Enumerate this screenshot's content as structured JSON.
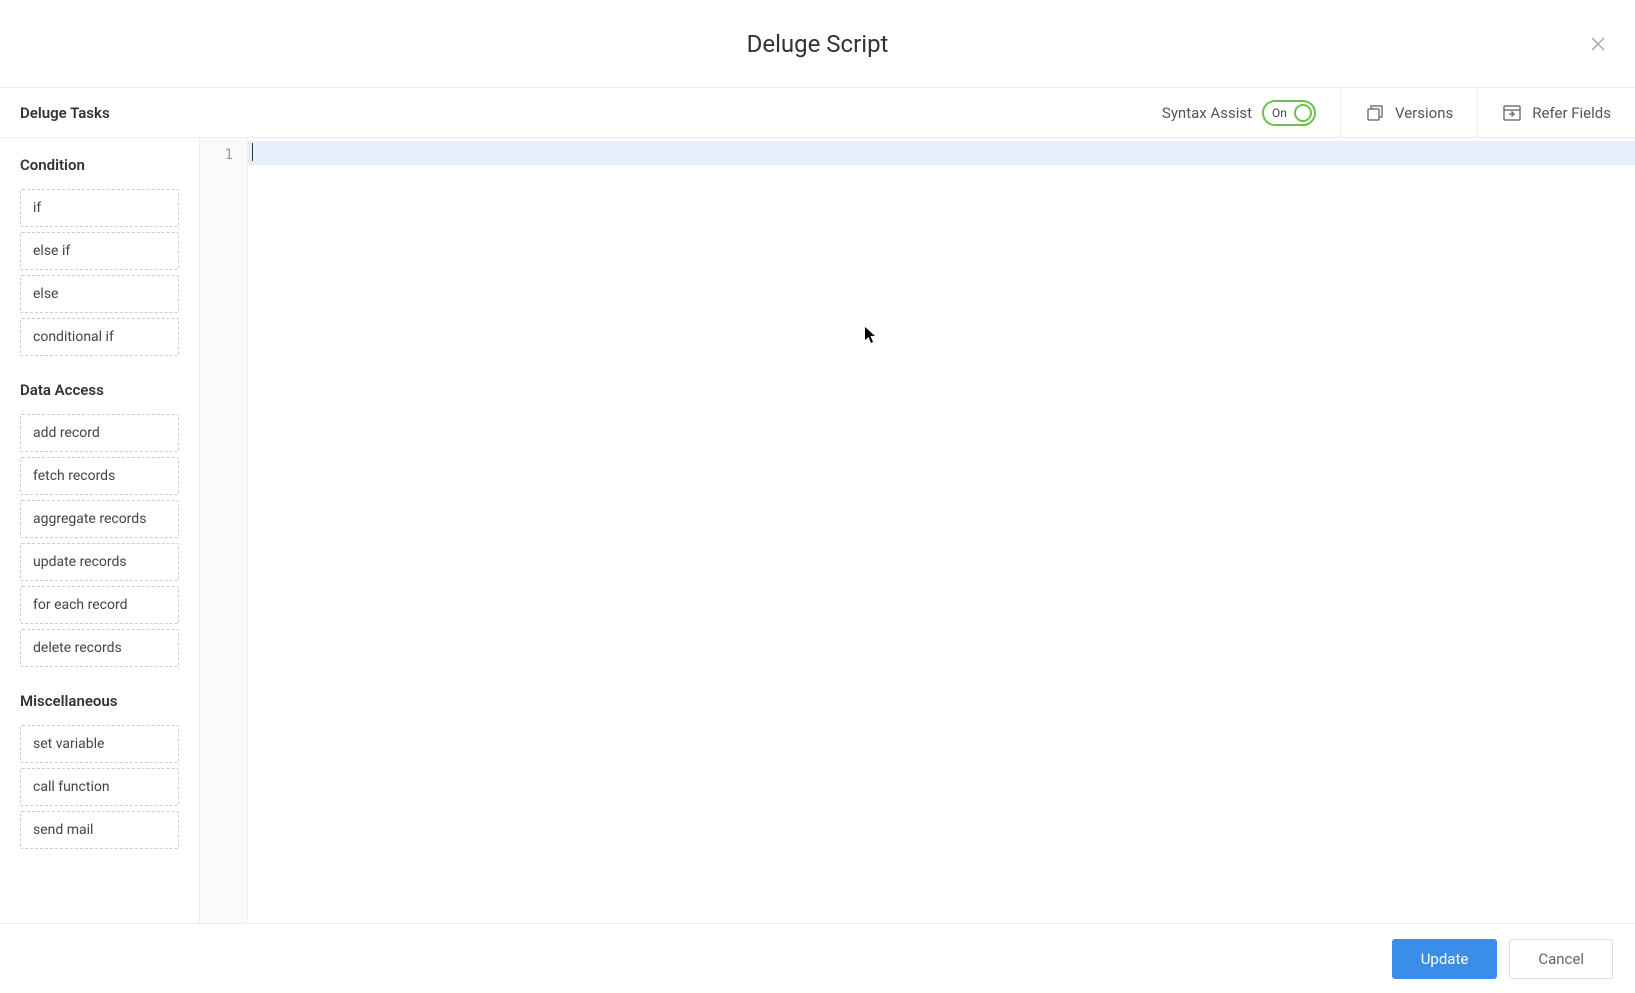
{
  "header": {
    "title": "Deluge Script"
  },
  "toolbar": {
    "tasks_label": "Deluge Tasks",
    "syntax_assist_label": "Syntax Assist",
    "syntax_assist_state": "On",
    "versions_label": "Versions",
    "refer_fields_label": "Refer Fields"
  },
  "sidebar": {
    "categories": [
      {
        "name": "Condition",
        "items": [
          "if",
          "else if",
          "else",
          "conditional if"
        ]
      },
      {
        "name": "Data Access",
        "items": [
          "add record",
          "fetch records",
          "aggregate records",
          "update records",
          "for each record",
          "delete records"
        ]
      },
      {
        "name": "Miscellaneous",
        "items": [
          "set variable",
          "call function",
          "send mail"
        ]
      }
    ]
  },
  "editor": {
    "line_numbers": [
      "1"
    ]
  },
  "footer": {
    "update_label": "Update",
    "cancel_label": "Cancel"
  }
}
